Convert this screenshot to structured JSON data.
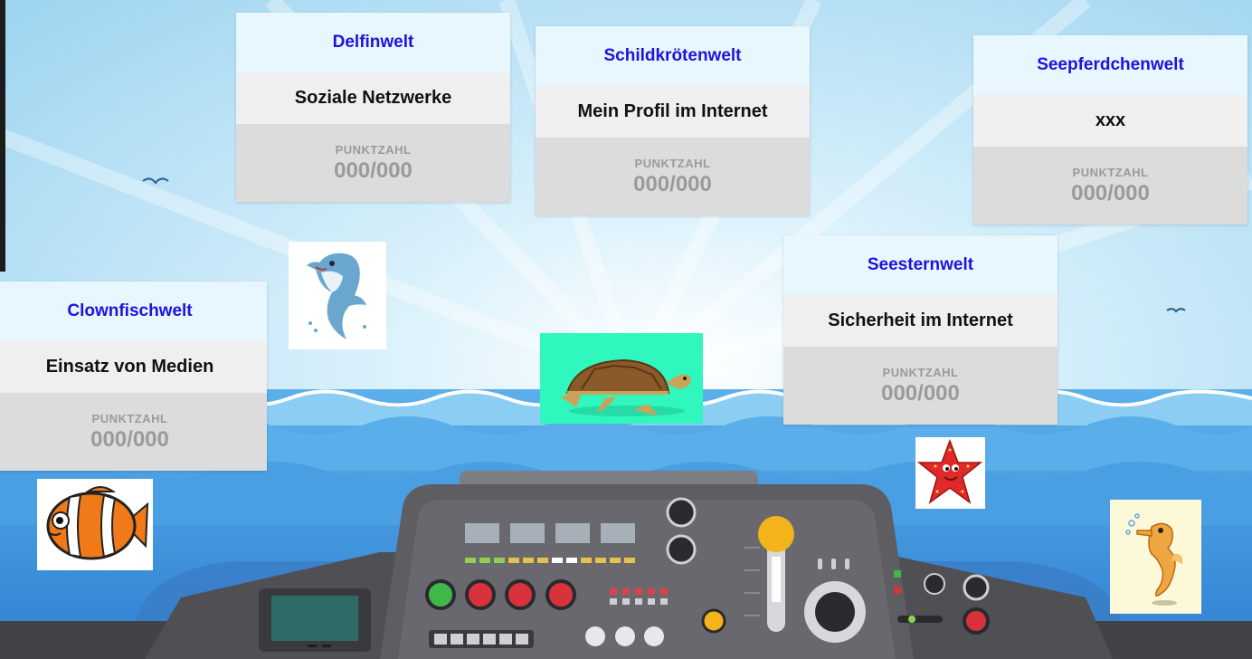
{
  "worlds": [
    {
      "title": "Delfinwelt",
      "topic": "Soziale Netzwerke",
      "score_label": "PUNKTZAHL",
      "score": "000/000"
    },
    {
      "title": "Schildkrötenwelt",
      "topic": "Mein Profil im Internet",
      "score_label": "PUNKTZAHL",
      "score": "000/000"
    },
    {
      "title": "Seepferdchenwelt",
      "topic": "xxx",
      "score_label": "PUNKTZAHL",
      "score": "000/000"
    },
    {
      "title": "Seesternwelt",
      "topic": "Sicherheit im Internet",
      "score_label": "PUNKTZAHL",
      "score": "000/000"
    },
    {
      "title": "Clownfischwelt",
      "topic": "Einsatz von Medien",
      "score_label": "PUNKTZAHL",
      "score": "000/000"
    }
  ],
  "animals": [
    "dolphin-icon",
    "turtle-icon",
    "starfish-icon",
    "seahorse-icon",
    "clownfish-icon"
  ],
  "colors": {
    "title_text": "#1a14e0",
    "sky": "#bfe6f8",
    "sea": "#3d8fdc",
    "dashboard": "#5d5d62"
  }
}
